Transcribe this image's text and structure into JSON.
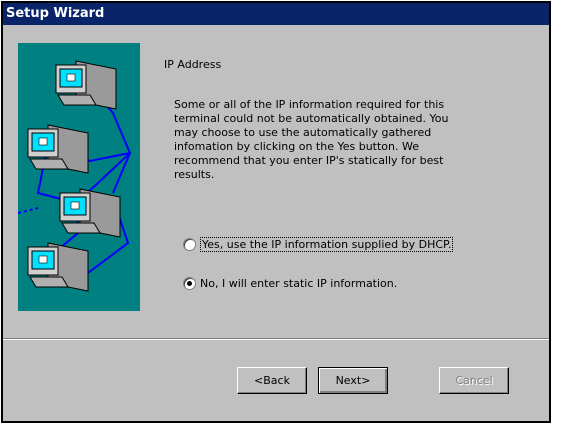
{
  "window": {
    "title": "Setup Wizard"
  },
  "page": {
    "heading": "IP Address",
    "description": "Some or all of the IP information required for this terminal could not be automatically obtained. You may choose to use the automatically gathered infomation by clicking on the Yes button.  We recommend that you enter IP's statically for best results."
  },
  "options": {
    "dhcp_label": "Yes, use the IP information supplied by DHCP.",
    "static_label": "No, I will enter static IP information.",
    "selected": "static"
  },
  "buttons": {
    "back": "<Back",
    "next": "Next>",
    "cancel": "Cancel"
  },
  "colors": {
    "titlebar": "#0a246a",
    "illustration_bg": "#008080",
    "network_line": "#0000ff"
  }
}
